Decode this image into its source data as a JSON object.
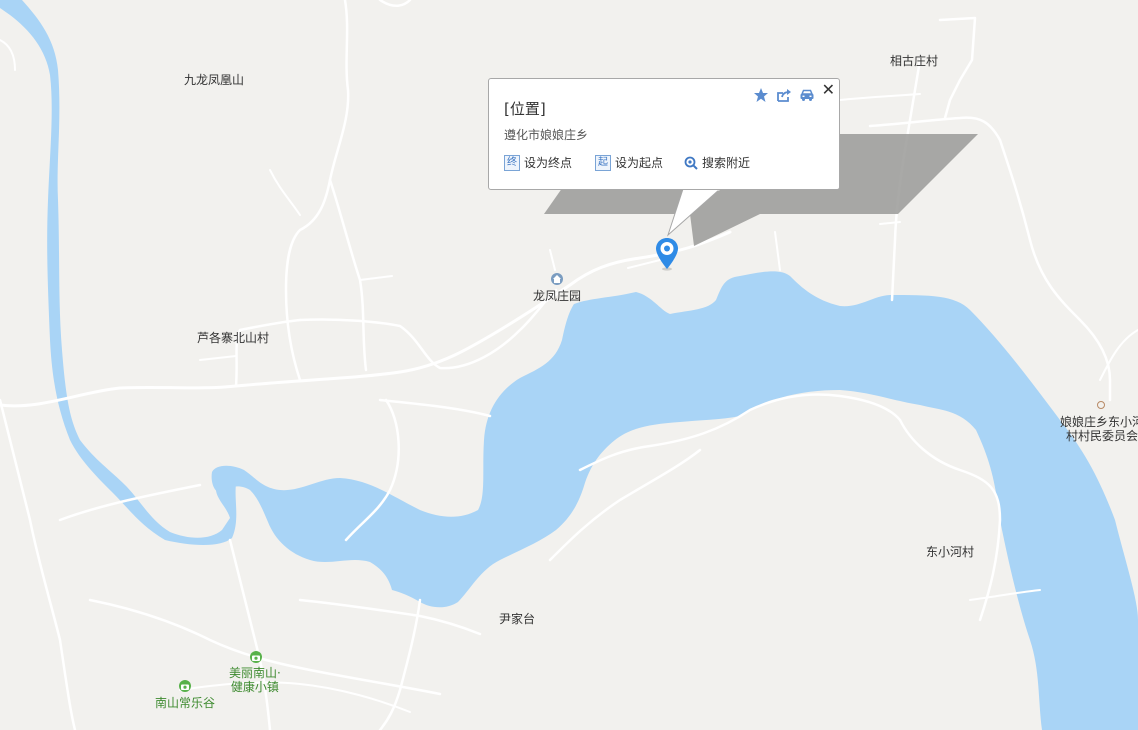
{
  "popup": {
    "title": "[位置]",
    "address": "遵化市娘娘庄乡",
    "actions": {
      "set_end": {
        "badge": "终",
        "label": "设为终点"
      },
      "set_start": {
        "badge": "起",
        "label": "设为起点"
      },
      "search_nearby": {
        "label": "搜索附近"
      }
    },
    "close": "✕",
    "toolbar_icons": [
      "star-icon",
      "share-icon",
      "car-icon"
    ]
  },
  "places": {
    "jiulong_fenghuangshan": "九龙凤凰山",
    "xianggu_zhuangcun": "相古庄村",
    "longfeng_zhuangyuan": "龙凤庄园",
    "lugezhai_beishancun": "芦各寨北山村",
    "niangniangzhuang_committee_line1": "娘娘庄乡东小河",
    "niangniangzhuang_committee_line2": "村村民委员会",
    "dongxiaohecun": "东小河村",
    "yinjiatai": "尹家台",
    "meili_nanshan_line1": "美丽南山·",
    "meili_nanshan_line2": "健康小镇",
    "nanshan_changlegu": "南山常乐谷"
  },
  "colors": {
    "land": "#f2f1ee",
    "water": "#a9d4f6",
    "road": "#ffffff",
    "marker": "#2f8be6",
    "poi_green": "#58b14a",
    "action_blue": "#3f78c3"
  },
  "icons": {
    "marker": "location-pin-icon",
    "poi_camera": "camera-icon",
    "poi_home": "home-icon",
    "poi_office": "office-dot-icon"
  }
}
